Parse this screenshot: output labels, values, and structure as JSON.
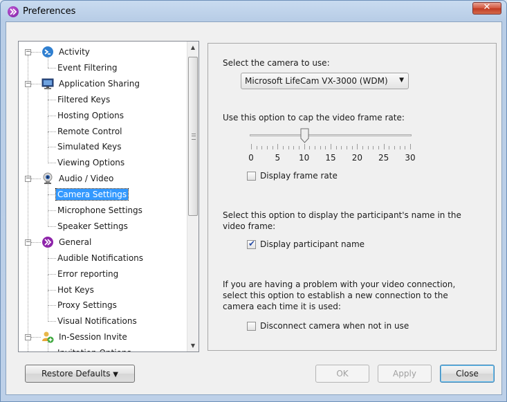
{
  "window": {
    "title": "Preferences",
    "close_glyph": "✕"
  },
  "tree": {
    "items": [
      {
        "label": "Activity",
        "level": 0,
        "expander": "−",
        "icon": "activity-icon"
      },
      {
        "label": "Event Filtering",
        "level": 1
      },
      {
        "label": "Application Sharing",
        "level": 0,
        "expander": "−",
        "icon": "monitor-icon"
      },
      {
        "label": "Filtered Keys",
        "level": 1
      },
      {
        "label": "Hosting Options",
        "level": 1
      },
      {
        "label": "Remote Control",
        "level": 1
      },
      {
        "label": "Simulated Keys",
        "level": 1
      },
      {
        "label": "Viewing Options",
        "level": 1
      },
      {
        "label": "Audio / Video",
        "level": 0,
        "expander": "−",
        "icon": "webcam-icon"
      },
      {
        "label": "Camera Settings",
        "level": 1,
        "selected": true
      },
      {
        "label": "Microphone Settings",
        "level": 1
      },
      {
        "label": "Speaker Settings",
        "level": 1
      },
      {
        "label": "General",
        "level": 0,
        "expander": "−",
        "icon": "app-logo-icon"
      },
      {
        "label": "Audible Notifications",
        "level": 1
      },
      {
        "label": "Error reporting",
        "level": 1
      },
      {
        "label": "Hot Keys",
        "level": 1
      },
      {
        "label": "Proxy Settings",
        "level": 1
      },
      {
        "label": "Visual Notifications",
        "level": 1
      },
      {
        "label": "In-Session Invite",
        "level": 0,
        "expander": "−",
        "icon": "invite-user-icon"
      },
      {
        "label": "Invitation Options",
        "level": 1
      }
    ]
  },
  "camera": {
    "select_label": "Select the camera to use:",
    "selected_camera": "Microsoft LifeCam VX-3000 (WDM)",
    "framerate_label": "Use this option to cap the video frame rate:",
    "framerate_value": 10,
    "framerate_min": 0,
    "framerate_max": 30,
    "tick_labels": [
      "0",
      "5",
      "10",
      "15",
      "20",
      "25",
      "30"
    ],
    "display_frame_rate_label": "Display frame rate",
    "display_frame_rate_checked": false,
    "participant_name_desc": "Select this option to display the participant's name in the video frame:",
    "display_participant_name_label": "Display participant name",
    "display_participant_name_checked": true,
    "reconnect_desc": "If you are having a problem with your video connection, select this option to establish a new connection to the camera each time it is used:",
    "disconnect_label": "Disconnect camera when not in use",
    "disconnect_checked": false,
    "check_glyph": "✔"
  },
  "buttons": {
    "restore_defaults": "Restore Defaults",
    "restore_arrow": "▼",
    "ok": "OK",
    "apply": "Apply",
    "close": "Close"
  },
  "colors": {
    "selection": "#3399ff",
    "accent": "#7b1fa2"
  }
}
